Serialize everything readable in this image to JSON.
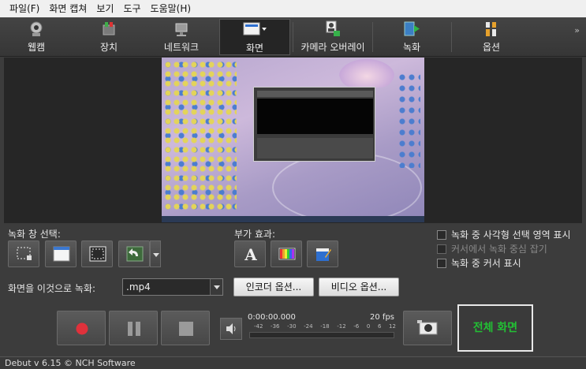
{
  "menu": [
    "파일(F)",
    "화면 캡쳐",
    "보기",
    "도구",
    "도움말(H)"
  ],
  "toolbar": {
    "items": [
      {
        "label": "웹캠",
        "icon": "webcam-icon"
      },
      {
        "label": "장치",
        "icon": "device-icon"
      },
      {
        "label": "네트워크",
        "icon": "network-icon"
      },
      {
        "label": "화면",
        "icon": "screen-icon",
        "active": true
      },
      {
        "label": "카메라 오버레이",
        "icon": "camera-overlay-icon"
      },
      {
        "label": "녹화",
        "icon": "record-video-icon"
      },
      {
        "label": "옵션",
        "icon": "options-icon"
      }
    ],
    "more": "»"
  },
  "capture_area": {
    "label": "녹화 창 선택:"
  },
  "effects": {
    "label": "부가 효과:"
  },
  "checkboxes": [
    {
      "label": "녹화 중 사각형 선택 영역 표시",
      "checked": false,
      "enabled": true
    },
    {
      "label": "커서에서 녹화 중심 잡기",
      "checked": false,
      "enabled": false
    },
    {
      "label": "녹화 중 커서 표시",
      "checked": false,
      "enabled": true
    }
  ],
  "record_as": {
    "label": "화면을 이것으로 녹화:",
    "format": ".mp4",
    "encoder_button": "인코더 옵션...",
    "video_button": "비디오 옵션..."
  },
  "meter": {
    "time": "0:00:00.000",
    "fps": "20 fps",
    "scale": [
      "-42",
      "-36",
      "-30",
      "-24",
      "-18",
      "-12",
      "-6",
      "0",
      "6",
      "12"
    ]
  },
  "fullscreen_button": "전체 화면",
  "status": "Debut v 6.15 © NCH Software",
  "colors": {
    "background": "#3c3c3c",
    "record_red": "#e0313b",
    "fullscreen_green": "#22c034"
  }
}
